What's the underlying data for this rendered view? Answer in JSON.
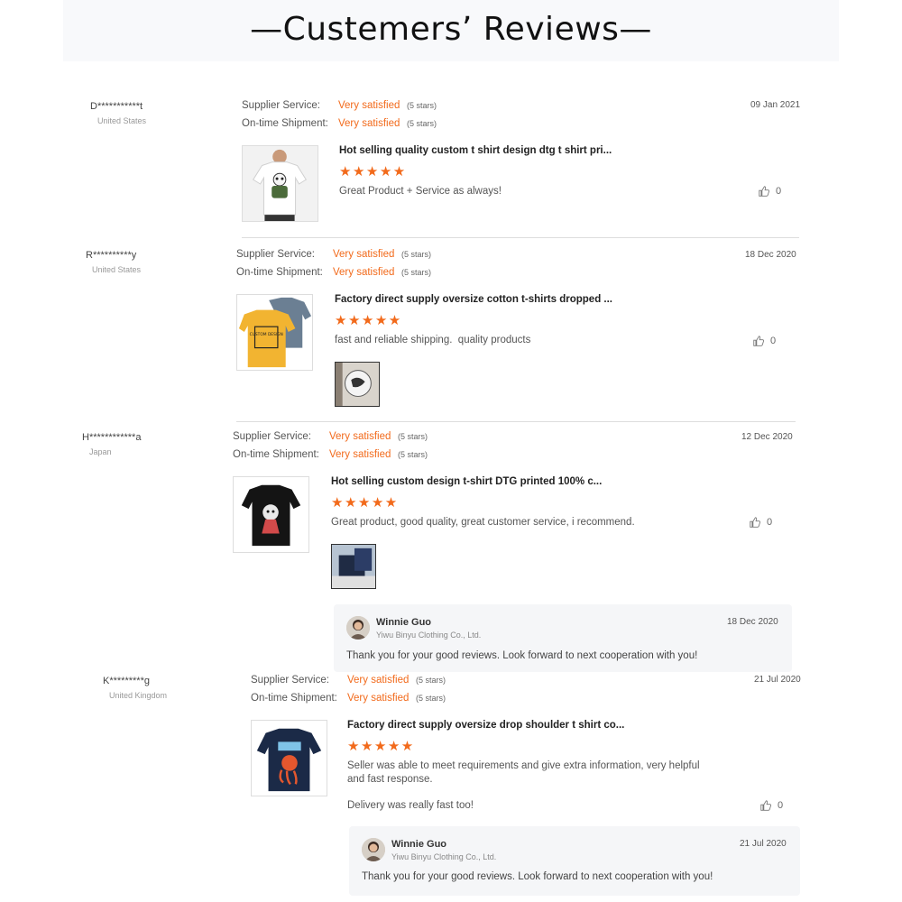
{
  "page": {
    "title": "—Custemers’ Reviews—"
  },
  "labels": {
    "supplier_service": "Supplier Service:",
    "ontime_shipment": "On-time Shipment:",
    "stars": "★★★★★"
  },
  "colors": {
    "accent": "#f26a1b",
    "divider": "#dddddd",
    "reply_bg": "#f5f6f8"
  },
  "reviews": [
    {
      "name": "D***********t",
      "country": "United States",
      "supplier_rating": "Very satisfied",
      "supplier_count": "(5 stars)",
      "shipment_rating": "Very satisfied",
      "shipment_count": "(5 stars)",
      "date": "09 Jan 2021",
      "product_title": "Hot selling quality custom t shirt design dtg t shirt pri...",
      "rating": 5,
      "comment": "Great Product + Service as always!",
      "likes": "0",
      "thumb_icon": "white-tshirt-panda-print"
    },
    {
      "name": "R**********y",
      "country": "United States",
      "supplier_rating": "Very satisfied",
      "supplier_count": "(5 stars)",
      "shipment_rating": "Very satisfied",
      "shipment_count": "(5 stars)",
      "date": "18 Dec 2020",
      "product_title": "Factory direct supply oversize cotton t-shirts dropped ...",
      "rating": 5,
      "comment": "fast and reliable shipping.  quality products",
      "likes": "0",
      "thumb_icon": "yellow-grey-tshirts",
      "thumb_text": "CUSTOM DESIGN"
    },
    {
      "name": "H************a",
      "country": "Japan",
      "supplier_rating": "Very satisfied",
      "supplier_count": "(5 stars)",
      "shipment_rating": "Very satisfied",
      "shipment_count": "(5 stars)",
      "date": "12 Dec 2020",
      "product_title": "Hot selling custom design t-shirt DTG printed 100% c...",
      "rating": 5,
      "comment": "Great product, good quality, great customer service, i recommend.",
      "likes": "0",
      "thumb_icon": "black-tshirt-print",
      "reply": {
        "name": "Winnie Guo",
        "company": "Yiwu Binyu Clothing Co., Ltd.",
        "date": "18 Dec 2020",
        "text": "Thank you for your good reviews. Look forward to next cooperation with you!"
      }
    },
    {
      "name": "K*********g",
      "country": "United Kingdom",
      "supplier_rating": "Very satisfied",
      "supplier_count": "(5 stars)",
      "shipment_rating": "Very satisfied",
      "shipment_count": "(5 stars)",
      "date": "21 Jul 2020",
      "product_title": "Factory direct supply oversize drop shoulder t shirt co...",
      "rating": 5,
      "comment": "Seller was able to meet requirements and give extra information, very helpful and fast response.",
      "comment2": "Delivery was really fast too!",
      "likes": "0",
      "thumb_icon": "navy-tshirt-octopus-print",
      "reply": {
        "name": "Winnie Guo",
        "company": "Yiwu Binyu Clothing Co., Ltd.",
        "date": "21 Jul 2020",
        "text": "Thank you for your good reviews. Look forward to next cooperation with you!"
      }
    }
  ]
}
